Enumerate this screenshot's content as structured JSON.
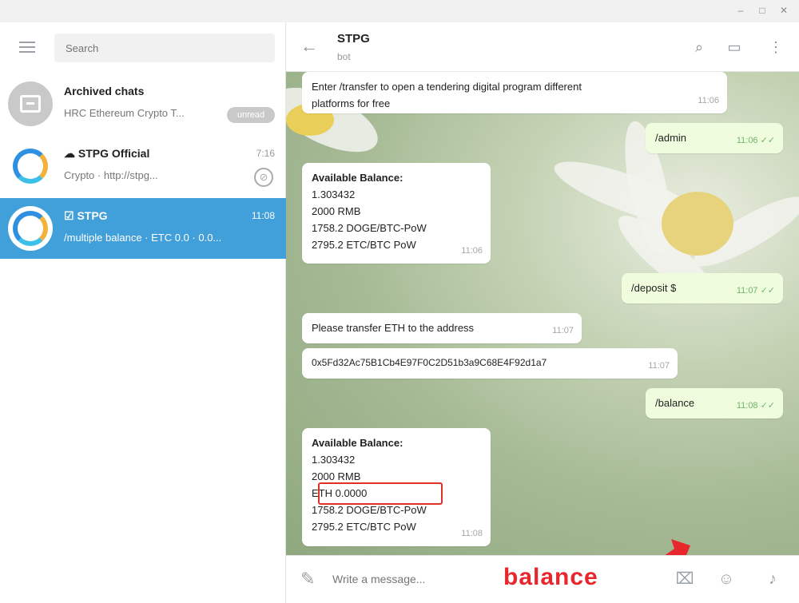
{
  "window": {
    "controls": [
      "–",
      "□",
      "✕"
    ]
  },
  "sidebar": {
    "search_placeholder": "Search",
    "chats": [
      {
        "name": "Archived chats",
        "preview": "HRC Ethereum Crypto T...",
        "badge": "unread"
      },
      {
        "name": "☁ STPG Official",
        "time": "7:16",
        "preview": "Crypto · http://stpg..."
      },
      {
        "name": "☑ STPG",
        "time": "11:08",
        "preview": "/multiple balance · ETC 0.0 · 0.0..."
      }
    ]
  },
  "header": {
    "title": "STPG",
    "subtitle": "bot"
  },
  "messages": [
    {
      "dir": "in",
      "lines": [
        "Enter /transfer to open a tendering digital program different",
        "platforms for free"
      ],
      "time": "11:06"
    },
    {
      "dir": "out",
      "lines": [
        "/admin"
      ],
      "time": "11:06"
    },
    {
      "dir": "in",
      "lines": [
        "Available Balance:",
        "1.303432",
        "2000 RMB",
        "1758.2 DOGE/BTC-PoW",
        "2795.2 ETC/BTC PoW"
      ],
      "time": "11:06"
    },
    {
      "dir": "out",
      "lines": [
        "/deposit $"
      ],
      "time": "11:07"
    },
    {
      "dir": "in",
      "lines": [
        "Please transfer ETH to the address"
      ],
      "time": "11:07"
    },
    {
      "dir": "in",
      "lines": [
        "0x5Fd32Ac75B1Cb4E97F0C2D51b3a9C68E4F92d1a7"
      ],
      "time": "11:07"
    },
    {
      "dir": "out",
      "lines": [
        "/balance"
      ],
      "time": "11:08"
    },
    {
      "dir": "in",
      "lines": [
        "Available Balance:",
        "1.303432",
        "2000 RMB",
        "ETH 0.0000",
        "1758.2 DOGE/BTC-PoW",
        "2795.2 ETC/BTC PoW"
      ],
      "time": "11:08"
    }
  ],
  "composer": {
    "placeholder": "Write a message...",
    "annotation": "balance"
  }
}
